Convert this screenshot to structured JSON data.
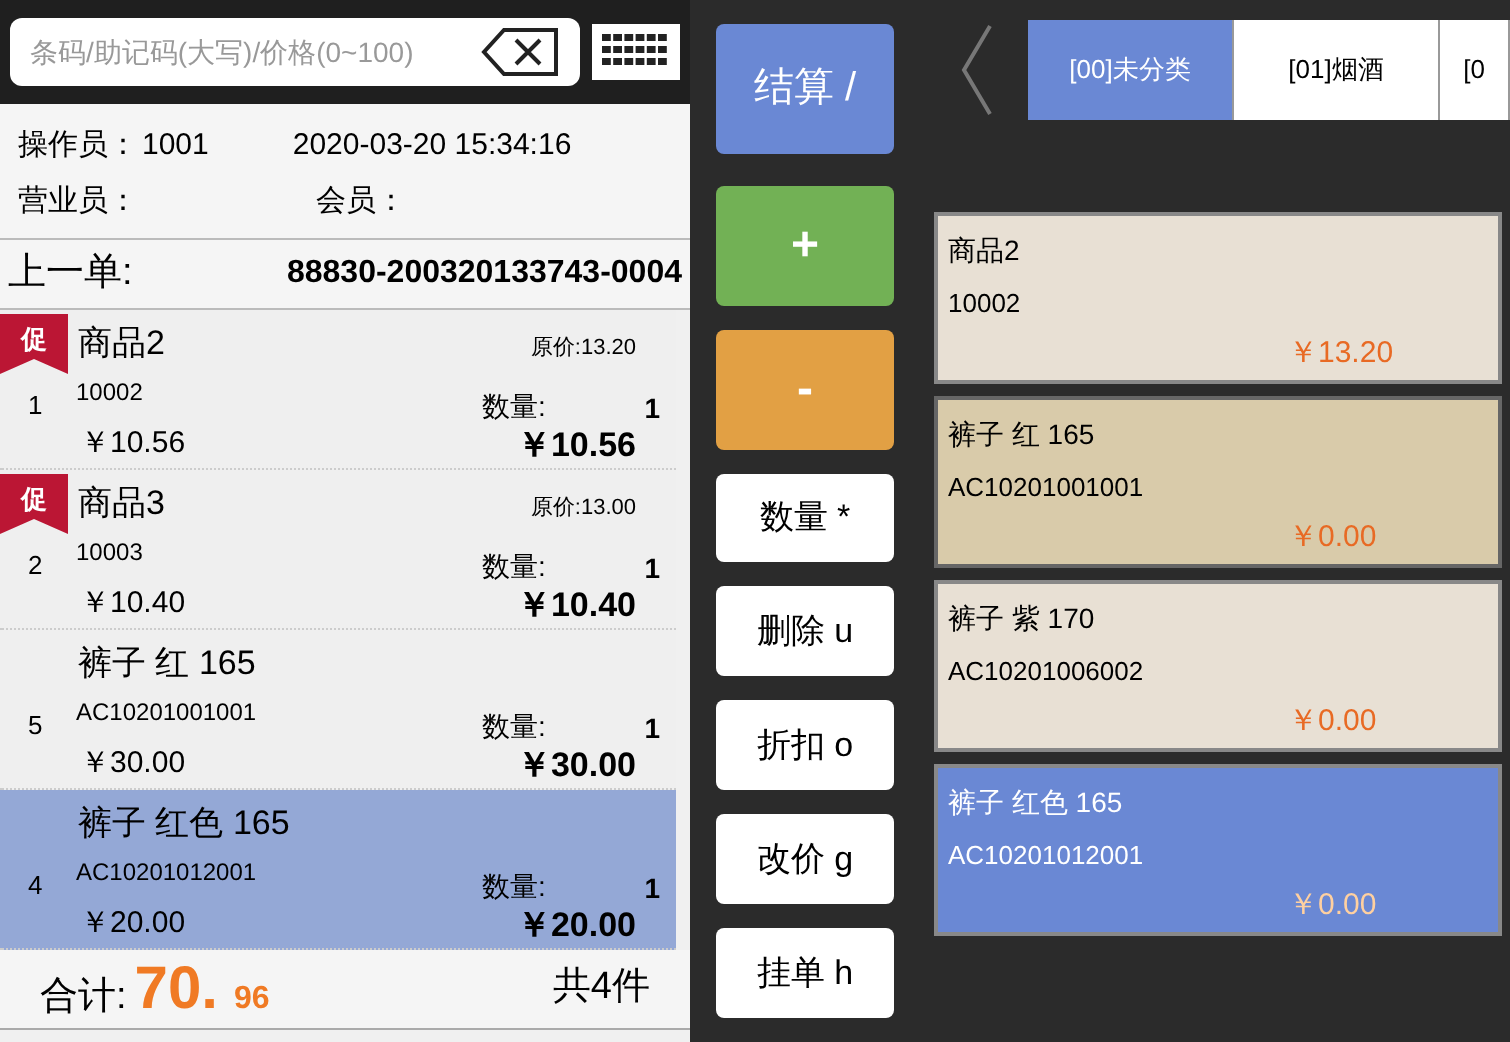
{
  "search": {
    "placeholder": "条码/助记码(大写)/价格(0~100)"
  },
  "info": {
    "operator_label": "操作员：",
    "operator": "1001",
    "datetime": "2020-03-20 15:34:16",
    "clerk_label": "营业员：",
    "member_label": "会员："
  },
  "last_order": {
    "label": "上一单:",
    "number": "88830-200320133743-0004"
  },
  "order_lines": [
    {
      "index": "1",
      "promo": true,
      "promo_label": "促",
      "name": "商品2",
      "code": "10002",
      "price": "￥10.56",
      "original_price": "原价:13.20",
      "qty_label": "数量:",
      "qty": "1",
      "amount": "￥10.56",
      "selected": false
    },
    {
      "index": "2",
      "promo": true,
      "promo_label": "促",
      "name": "商品3",
      "code": "10003",
      "price": "￥10.40",
      "original_price": "原价:13.00",
      "qty_label": "数量:",
      "qty": "1",
      "amount": "￥10.40",
      "selected": false
    },
    {
      "index": "5",
      "promo": false,
      "name": "裤子 红 165",
      "code": "AC10201001001",
      "price": "￥30.00",
      "qty_label": "数量:",
      "qty": "1",
      "amount": "￥30.00",
      "selected": false
    },
    {
      "index": "4",
      "promo": false,
      "name": "裤子 红色 165",
      "code": "AC10201012001",
      "price": "￥20.00",
      "qty_label": "数量:",
      "qty": "1",
      "amount": "￥20.00",
      "selected": true
    }
  ],
  "totals": {
    "label": "合计:",
    "integer": "70.",
    "decimal": "96",
    "count": "共4件"
  },
  "actions": [
    {
      "label": "结算 /",
      "kind": "checkout"
    },
    {
      "label": "+",
      "kind": "plus"
    },
    {
      "label": "-",
      "kind": "minus"
    },
    {
      "label": "数量 *",
      "kind": "plain"
    },
    {
      "label": "删除 u",
      "kind": "plain"
    },
    {
      "label": "折扣 o",
      "kind": "plain"
    },
    {
      "label": "改价 g",
      "kind": "plain"
    },
    {
      "label": "挂单 h",
      "kind": "plain"
    }
  ],
  "category_tabs": [
    {
      "label": "[00]未分类",
      "selected": true
    },
    {
      "label": "[01]烟酒",
      "selected": false
    },
    {
      "label": "[0",
      "selected": false
    }
  ],
  "products": [
    {
      "name": "商品2",
      "code": "10002",
      "price": "￥13.20",
      "selected": false,
      "highlighted": false
    },
    {
      "name": "裤子 红 165",
      "code": "AC10201001001",
      "price": "￥0.00",
      "selected": false,
      "highlighted": true
    },
    {
      "name": "裤子 紫 170",
      "code": "AC10201006002",
      "price": "￥0.00",
      "selected": false,
      "highlighted": false
    },
    {
      "name": "裤子 红色 165",
      "code": "AC10201012001",
      "price": "￥0.00",
      "selected": true,
      "highlighted": false
    }
  ]
}
